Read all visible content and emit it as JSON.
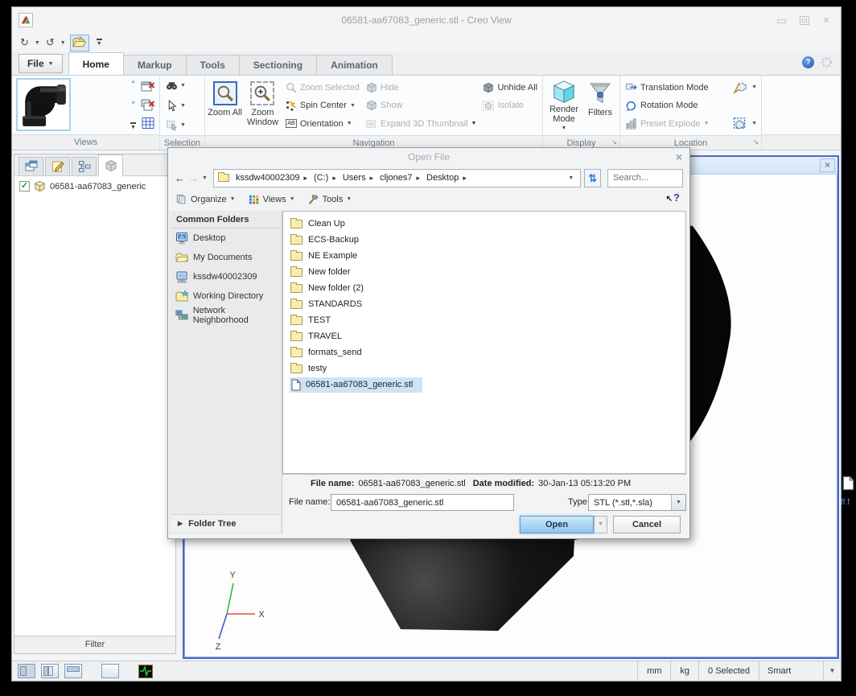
{
  "window": {
    "title": "06581-aa67083_generic.stl - Creo View"
  },
  "tabs": {
    "file": "File",
    "items": [
      "Home",
      "Markup",
      "Tools",
      "Sectioning",
      "Animation"
    ]
  },
  "ribbon": {
    "groups": {
      "views": "Views",
      "selection": "Selection",
      "navigation": "Navigation",
      "display": "Display",
      "location": "Location"
    },
    "zoom_all": "Zoom All",
    "zoom_window": "Zoom Window",
    "zoom_selected": "Zoom Selected",
    "spin_center": "Spin Center",
    "orientation": "Orientation",
    "hide": "Hide",
    "show": "Show",
    "expand_3d": "Expand 3D Thumbnail",
    "unhide_all": "Unhide All",
    "isolate": "Isolate",
    "render_mode": "Render Mode",
    "filters": "Filters",
    "translation_mode": "Translation Mode",
    "rotation_mode": "Rotation Mode",
    "preset_explode": "Preset Explode"
  },
  "left_panel": {
    "tree_item": "06581-aa67083_generic",
    "filter": "Filter"
  },
  "viewport": {
    "axis": {
      "x": "X",
      "y": "Y",
      "z": "Z"
    }
  },
  "desktop": {
    "shortcut": "ff.f"
  },
  "dialog": {
    "title": "Open File",
    "breadcrumb": [
      "kssdw40002309",
      "(C:)",
      "Users",
      "cljones7",
      "Desktop"
    ],
    "search_placeholder": "Search...",
    "toolbar": {
      "organize": "Organize",
      "views": "Views",
      "tools": "Tools"
    },
    "sidebar": {
      "header": "Common Folders",
      "items": [
        "Desktop",
        "My Documents",
        "kssdw40002309",
        "Working Directory",
        "Network Neighborhood"
      ]
    },
    "folders": [
      "Clean Up",
      "ECS-Backup",
      "NE Example",
      "New folder",
      "New folder (2)",
      "STANDARDS",
      "TEST",
      "TRAVEL",
      "formats_send",
      "testy"
    ],
    "selected_file": "06581-aa67083_generic.stl",
    "info": {
      "file_name_label": "File name:",
      "file_name": "06581-aa67083_generic.stl",
      "date_label": "Date modified:",
      "date": "30-Jan-13 05:13:20 PM"
    },
    "footer": {
      "file_name_label": "File name:",
      "file_name_value": "06581-aa67083_generic.stl",
      "type_label": "Type",
      "type_value": "STL (*.stl,*.sla)",
      "open": "Open",
      "cancel": "Cancel",
      "folder_tree": "Folder Tree"
    }
  },
  "status": {
    "mm": "mm",
    "kg": "kg",
    "selected": "0 Selected",
    "mode": "Smart"
  },
  "colors": {
    "open_button": "#a8d7f5",
    "selection_highlight": "#cde4f5",
    "viewport_border": "#4a6bc8",
    "axis_x": "#ef4b3e",
    "axis_y": "#35b44a",
    "axis_z": "#4750d8"
  }
}
